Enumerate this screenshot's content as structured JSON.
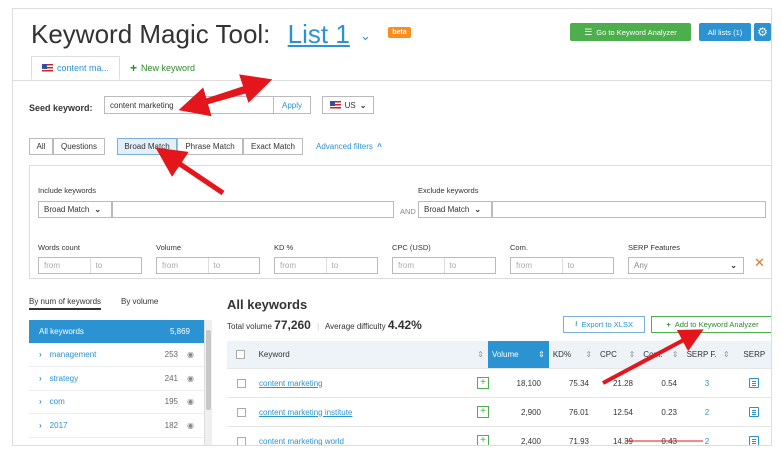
{
  "header": {
    "title": "Keyword Magic Tool:",
    "list_name": "List 1",
    "list_caret": "⌄",
    "beta_badge": "beta",
    "go_analyzer_label": "Go to Keyword Analyzer",
    "all_lists_label": "All lists (1)"
  },
  "tabs": {
    "active_label": "content ma...",
    "new_label": "New keyword"
  },
  "seed": {
    "label": "Seed keyword:",
    "value": "content marketing",
    "apply_label": "Apply",
    "database": "US"
  },
  "match_tabs": [
    {
      "label": "All"
    },
    {
      "label": "Questions"
    },
    {
      "label": "Broad Match"
    },
    {
      "label": "Phrase Match"
    },
    {
      "label": "Exact Match"
    }
  ],
  "advanced_filters_label": "Advanced filters",
  "filters": {
    "include_label": "Include keywords",
    "include_mode": "Broad Match",
    "and_label": "AND",
    "exclude_label": "Exclude keywords",
    "exclude_mode": "Broad Match",
    "words_count_label": "Words count",
    "volume_label": "Volume",
    "kd_label": "KD %",
    "cpc_label": "CPC (USD)",
    "com_label": "Com.",
    "serp_features_label": "SERP Features",
    "from_placeholder": "from",
    "to_placeholder": "to",
    "serp_features_value": "Any"
  },
  "sidebar": {
    "by_num_label": "By num of keywords",
    "by_volume_label": "By volume",
    "items": [
      {
        "label": "All keywords",
        "count": "5,869"
      },
      {
        "label": "management",
        "count": "253"
      },
      {
        "label": "strategy",
        "count": "241"
      },
      {
        "label": "com",
        "count": "195"
      },
      {
        "label": "2017",
        "count": "182"
      }
    ]
  },
  "results": {
    "title": "All keywords",
    "total_volume_label": "Total volume",
    "total_volume": "77,260",
    "avg_difficulty_label": "Average difficulty",
    "avg_difficulty": "4.42%",
    "export_label": "Export to XLSX",
    "add_label": "Add to Keyword Analyzer",
    "columns": {
      "keyword": "Keyword",
      "volume": "Volume",
      "kd": "KD%",
      "cpc": "CPC",
      "com": "Com.",
      "serp_features": "SERP F.",
      "serp": "SERP"
    },
    "rows": [
      {
        "keyword": "content marketing",
        "volume": "18,100",
        "kd": "75.34",
        "cpc": "21.28",
        "com": "0.54",
        "serp_features": "3"
      },
      {
        "keyword": "content marketing institute",
        "volume": "2,900",
        "kd": "76.01",
        "cpc": "12.54",
        "com": "0.23",
        "serp_features": "2"
      },
      {
        "keyword": "content marketing world",
        "volume": "2,400",
        "kd": "71.93",
        "cpc": "14.39",
        "com": "0.43",
        "serp_features": "2"
      }
    ]
  },
  "colors": {
    "primary_blue": "#2b93d1",
    "green": "#4cae4c",
    "beta_orange": "#ff8c1a",
    "annotation_red": "#e5161b"
  }
}
